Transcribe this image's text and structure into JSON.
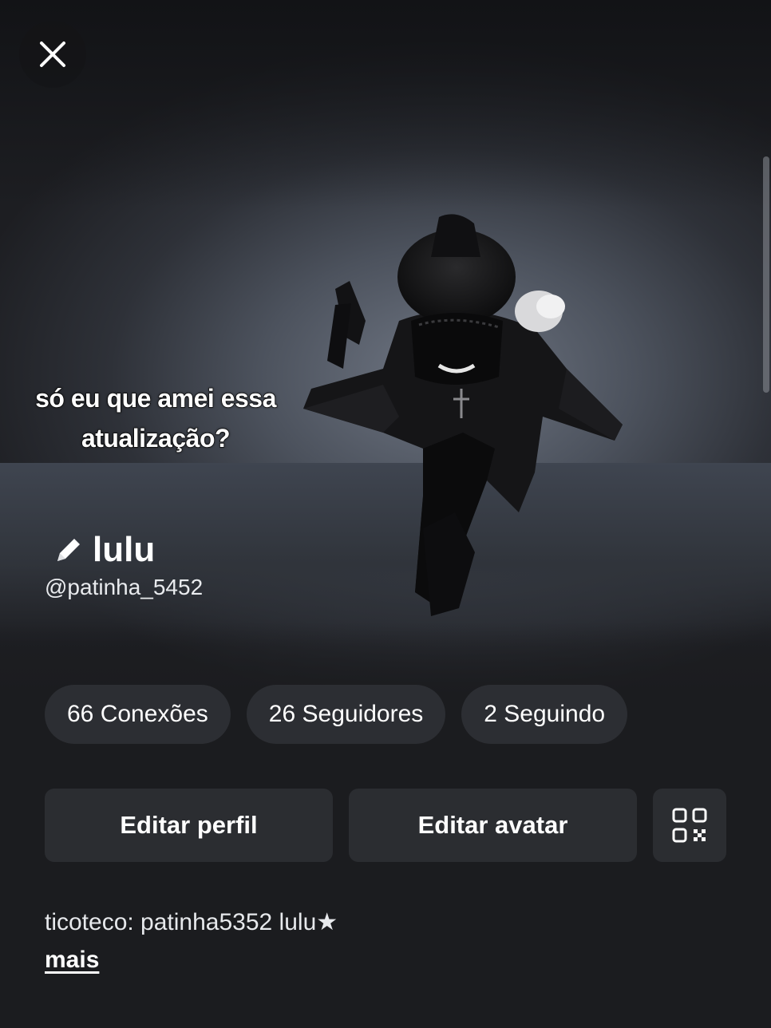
{
  "header": {
    "close_icon": "close-icon"
  },
  "avatar": {
    "caption_line1": "só eu que amei essa",
    "caption_line2": "atualização?"
  },
  "profile": {
    "display_name": "lulu",
    "username": "@patinha_5452",
    "edit_name_icon": "pencil-icon"
  },
  "stats": [
    {
      "label": "66 Conexões"
    },
    {
      "label": "26 Seguidores"
    },
    {
      "label": "2 Seguindo"
    }
  ],
  "actions": {
    "edit_profile": "Editar perfil",
    "edit_avatar": "Editar avatar",
    "qr_icon": "qr-code-icon"
  },
  "bio": {
    "text": "ticoteco: patinha5352 lulu★",
    "more": "mais"
  }
}
